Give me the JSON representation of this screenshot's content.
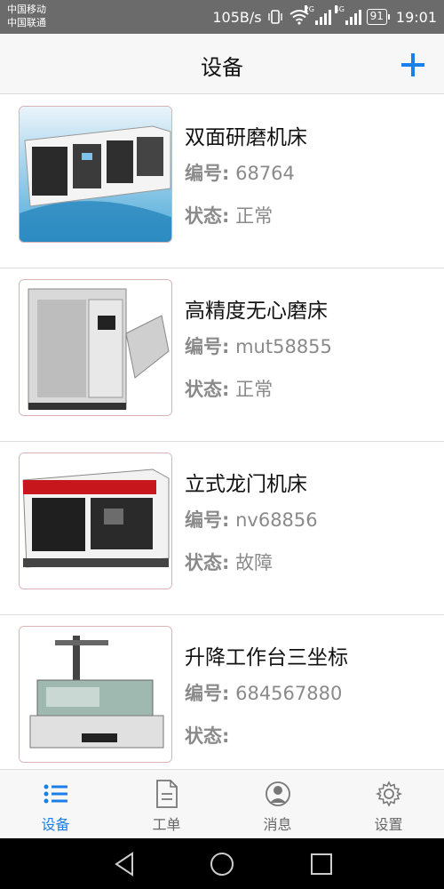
{
  "status_bar": {
    "carrier1": "中国移动",
    "carrier2": "中国联通",
    "speed": "105B/s",
    "net_2g": "2G",
    "net_4g": "4G",
    "battery": "91",
    "time": "19:01"
  },
  "header": {
    "title": "设备",
    "add_icon": "plus-icon"
  },
  "devices": [
    {
      "name": "双面研磨机床",
      "id_label": "编号:",
      "id": "68764",
      "status_label": "状态:",
      "status": "正常"
    },
    {
      "name": "高精度无心磨床",
      "id_label": "编号:",
      "id": "mut58855",
      "status_label": "状态:",
      "status": "正常"
    },
    {
      "name": "立式龙门机床",
      "id_label": "编号:",
      "id": "nv68856",
      "status_label": "状态:",
      "status": "故障"
    },
    {
      "name": "升降工作台三坐标",
      "id_label": "编号:",
      "id": "684567880",
      "status_label": "状态:",
      "status": ""
    }
  ],
  "tabs": [
    {
      "label": "设备",
      "icon": "list-icon",
      "active": true
    },
    {
      "label": "工单",
      "icon": "document-icon",
      "active": false
    },
    {
      "label": "消息",
      "icon": "user-icon",
      "active": false
    },
    {
      "label": "设置",
      "icon": "gear-icon",
      "active": false
    }
  ],
  "colors": {
    "accent": "#1a7fe8",
    "status_bar": "#6b6b6b",
    "muted_text": "#8a8a8a"
  }
}
